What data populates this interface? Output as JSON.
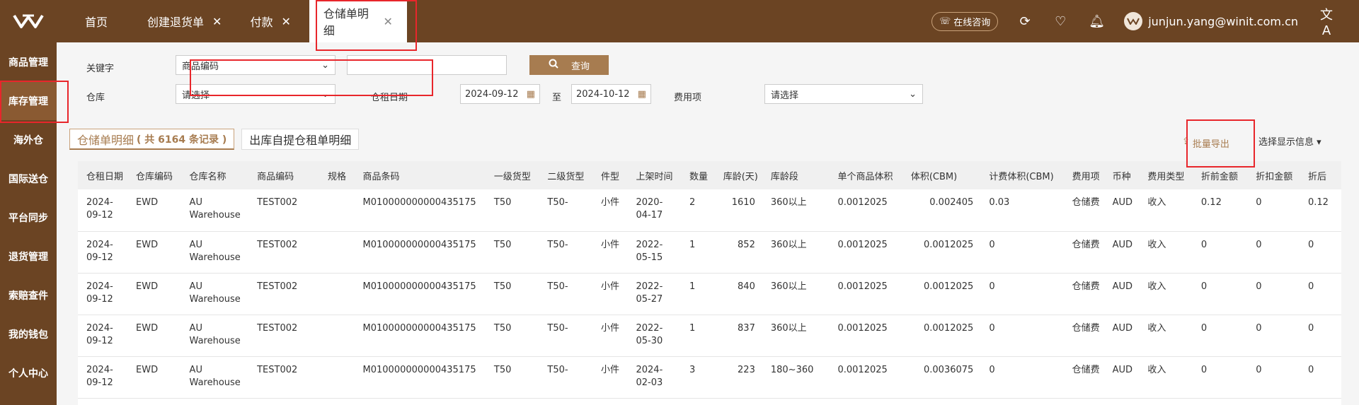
{
  "header": {
    "tabs": [
      {
        "label": "首页",
        "closable": false
      },
      {
        "label": "创建退货单",
        "closable": true
      },
      {
        "label": "付款",
        "closable": true
      },
      {
        "label": "仓储单明细",
        "closable": true,
        "active": true
      }
    ],
    "consult_label": "在线咨询",
    "user_email": "junjun.yang@winit.com.cn"
  },
  "sidebar": {
    "items": [
      {
        "label": "商品管理"
      },
      {
        "label": "库存管理",
        "active": true
      },
      {
        "label": "海外仓"
      },
      {
        "label": "国际送仓"
      },
      {
        "label": "平台同步"
      },
      {
        "label": "退货管理"
      },
      {
        "label": "索赔查件"
      },
      {
        "label": "我的钱包"
      },
      {
        "label": "个人中心"
      }
    ]
  },
  "filters": {
    "keyword_label": "关键字",
    "keyword_type": "商品编码",
    "keyword_value": "",
    "search_button": "查询",
    "warehouse_label": "仓库",
    "warehouse_value": "请选择",
    "rent_date_label": "仓租日期",
    "date_from": "2024-09-12",
    "date_to_label": "至",
    "date_to": "2024-10-12",
    "fee_item_label": "费用项",
    "fee_item_value": "请选择"
  },
  "subtabs": {
    "tab1_title": "仓储单明细",
    "tab1_count": "( 共 6164 条记录 )",
    "tab2_title": "出库自提仓租单明细"
  },
  "toolbar": {
    "export_label": "批量导出",
    "show_info_label": "选择显示信息"
  },
  "table": {
    "columns": [
      "仓租日期",
      "仓库编码",
      "仓库名称",
      "商品编码",
      "规格",
      "商品条码",
      "一级货型",
      "二级货型",
      "件型",
      "上架时间",
      "数量",
      "库龄(天)",
      "库龄段",
      "单个商品体积",
      "体积(CBM)",
      "计费体积(CBM)",
      "费用项",
      "币种",
      "费用类型",
      "折前金额",
      "折扣金额",
      "折后"
    ],
    "rows": [
      {
        "date": "2024-\n09-12",
        "wh_code": "EWD",
        "wh_name": "AU\nWarehouse",
        "sku": "TEST002",
        "spec": "",
        "barcode": "M010000000000435175",
        "t1": "T50",
        "t2": "T50-",
        "piece": "小件",
        "shelf": "2020-\n04-17",
        "qty": "2",
        "age": "1610",
        "age_seg": "360以上",
        "unit_vol": "0.0012025",
        "vol": "0.002405",
        "bill_vol": "0.03",
        "fee": "仓储费",
        "cur": "AUD",
        "fee_type": "收入",
        "pre": "0.12",
        "disc": "0",
        "post": "0.12"
      },
      {
        "date": "2024-\n09-12",
        "wh_code": "EWD",
        "wh_name": "AU\nWarehouse",
        "sku": "TEST002",
        "spec": "",
        "barcode": "M010000000000435175",
        "t1": "T50",
        "t2": "T50-",
        "piece": "小件",
        "shelf": "2022-\n05-15",
        "qty": "1",
        "age": "852",
        "age_seg": "360以上",
        "unit_vol": "0.0012025",
        "vol": "0.0012025",
        "bill_vol": "0",
        "fee": "仓储费",
        "cur": "AUD",
        "fee_type": "收入",
        "pre": "0",
        "disc": "0",
        "post": "0"
      },
      {
        "date": "2024-\n09-12",
        "wh_code": "EWD",
        "wh_name": "AU\nWarehouse",
        "sku": "TEST002",
        "spec": "",
        "barcode": "M010000000000435175",
        "t1": "T50",
        "t2": "T50-",
        "piece": "小件",
        "shelf": "2022-\n05-27",
        "qty": "1",
        "age": "840",
        "age_seg": "360以上",
        "unit_vol": "0.0012025",
        "vol": "0.0012025",
        "bill_vol": "0",
        "fee": "仓储费",
        "cur": "AUD",
        "fee_type": "收入",
        "pre": "0",
        "disc": "0",
        "post": "0"
      },
      {
        "date": "2024-\n09-12",
        "wh_code": "EWD",
        "wh_name": "AU\nWarehouse",
        "sku": "TEST002",
        "spec": "",
        "barcode": "M010000000000435175",
        "t1": "T50",
        "t2": "T50-",
        "piece": "小件",
        "shelf": "2022-\n05-30",
        "qty": "1",
        "age": "837",
        "age_seg": "360以上",
        "unit_vol": "0.0012025",
        "vol": "0.0012025",
        "bill_vol": "0",
        "fee": "仓储费",
        "cur": "AUD",
        "fee_type": "收入",
        "pre": "0",
        "disc": "0",
        "post": "0"
      },
      {
        "date": "2024-\n09-12",
        "wh_code": "EWD",
        "wh_name": "AU\nWarehouse",
        "sku": "TEST002",
        "spec": "",
        "barcode": "M010000000000435175",
        "t1": "T50",
        "t2": "T50-",
        "piece": "小件",
        "shelf": "2024-\n02-03",
        "qty": "3",
        "age": "223",
        "age_seg": "180~360",
        "unit_vol": "0.0012025",
        "vol": "0.0036075",
        "bill_vol": "0",
        "fee": "仓储费",
        "cur": "AUD",
        "fee_type": "收入",
        "pre": "0",
        "disc": "0",
        "post": "0"
      }
    ]
  },
  "colors": {
    "brand_brown": "#6b4423",
    "accent": "#a77c50",
    "highlight_red": "#e8262b"
  }
}
